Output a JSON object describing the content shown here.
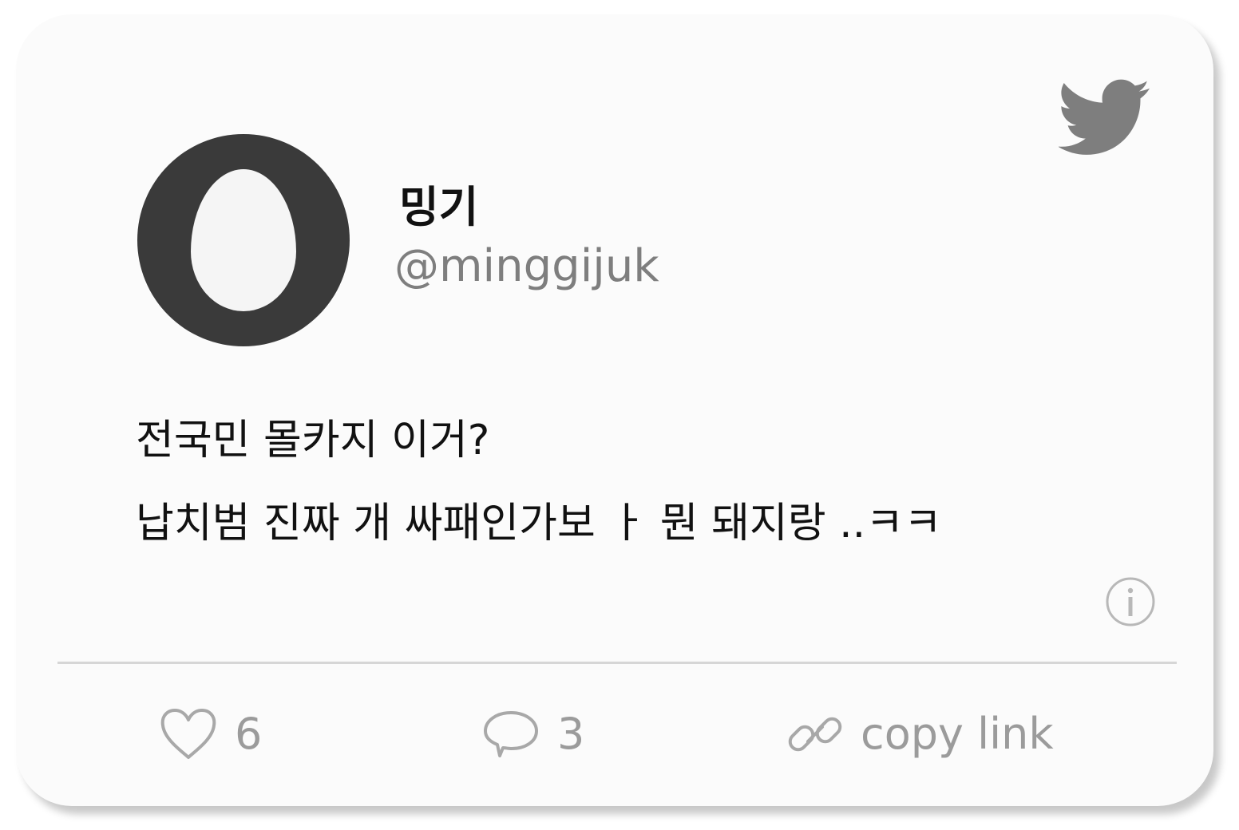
{
  "user": {
    "display_name": "밍기",
    "handle": "@minggijuk"
  },
  "tweet": {
    "lines": [
      "전국민 몰카지 이거?",
      "납치범 진짜 개 싸패인가보 ㅏ 뭔 돼지랑 ..ㅋㅋ"
    ]
  },
  "actions": {
    "likes": "6",
    "replies": "3",
    "copy_link": "copy link"
  },
  "icons": {
    "brand": "twitter-bird-icon",
    "info": "info-icon",
    "like": "heart-icon",
    "reply": "speech-bubble-icon",
    "link": "link-icon"
  },
  "colors": {
    "card_background": "#fbfbfb",
    "avatar": "#3a3a3a",
    "muted": "#9b9b9b",
    "handle": "#7e7e7e"
  }
}
